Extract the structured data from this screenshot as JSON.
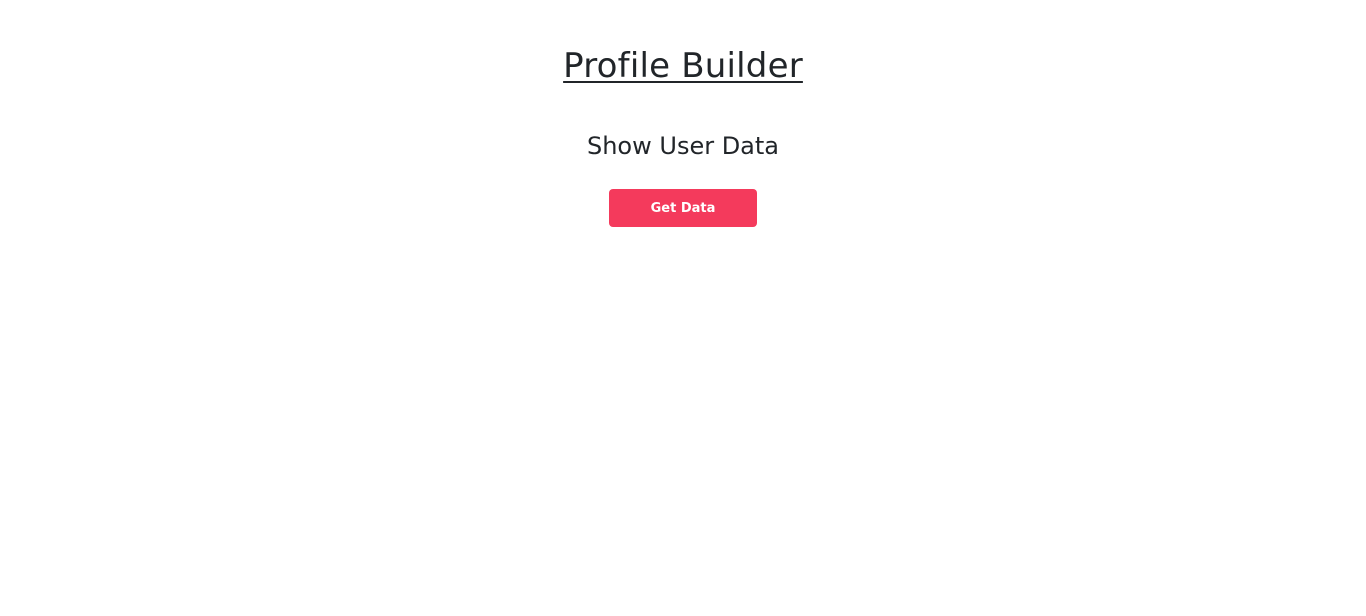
{
  "page": {
    "title": "Profile Builder",
    "subtitle": "Show User Data"
  },
  "actions": {
    "get_data_label": "Get Data"
  },
  "colors": {
    "text": "#212529",
    "button_bg": "#f43a5c",
    "button_text": "#ffffff",
    "background": "#ffffff"
  }
}
